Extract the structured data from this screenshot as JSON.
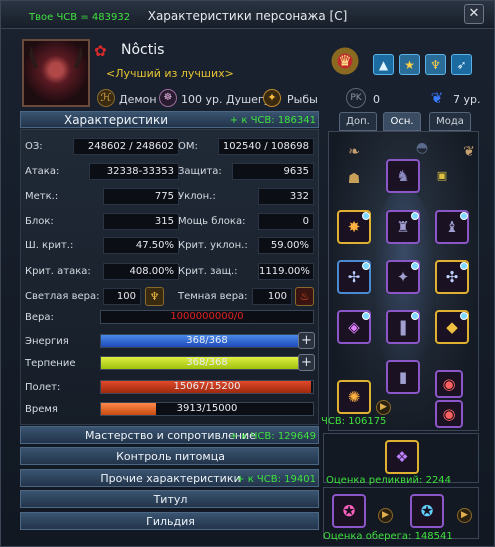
{
  "window": {
    "title": "Характеристики персонажа [C]",
    "score": "Твое ЧСВ = 483932",
    "close": "✕"
  },
  "character": {
    "name": "Nôctis",
    "title": "Лучший из лучших",
    "race": "Демон",
    "level": "100 ур. Душегуб",
    "profession": "Рыбы",
    "pk": "0",
    "rank_level": "7 ур."
  },
  "stats_header": {
    "label": "Характеристики",
    "bonus": "+ к ЧСВ: 186341"
  },
  "stats": {
    "hp_label": "ОЗ:",
    "hp": "248602 / 248602",
    "mp_label": "ОМ:",
    "mp": "102540 / 108698",
    "attack_label": "Атака:",
    "attack": "32338-33353",
    "defense_label": "Защита:",
    "defense": "9635",
    "accuracy_label": "Метк.:",
    "accuracy": "775",
    "evasion_label": "Уклон.:",
    "evasion": "332",
    "block_label": "Блок:",
    "block": "315",
    "block_power_label": "Мощь блока:",
    "block_power": "0",
    "crit_chance_label": "Ш. крит.:",
    "crit_chance": "47.50%",
    "crit_evasion_label": "Крит. уклон.:",
    "crit_evasion": "59.00%",
    "crit_attack_label": "Крит. атака:",
    "crit_attack": "408.00%",
    "crit_defense_label": "Крит. защ.:",
    "crit_defense": "1119.00%",
    "light_faith_label": "Светлая вера:",
    "light_faith": "100",
    "dark_faith_label": "Темная вера:",
    "dark_faith": "100"
  },
  "bars": {
    "faith": {
      "label": "Вера:",
      "value": "1000000000/0",
      "fill": 0
    },
    "energy": {
      "label": "Энергия",
      "value": "368/368",
      "fill": 1.0
    },
    "patience": {
      "label": "Терпение",
      "value": "368/368",
      "fill": 1.0
    },
    "flight": {
      "label": "Полет:",
      "value": "15067/15200",
      "fill": 0.991
    },
    "time": {
      "label": "Время",
      "value": "3913/15000",
      "fill": 0.261
    }
  },
  "sections": [
    {
      "label": "Мастерство и сопротивление",
      "bonus": "+ к ЧСВ: 129649"
    },
    {
      "label": "Контроль питомца",
      "bonus": ""
    },
    {
      "label": "Прочие характеристики",
      "bonus": "+ к ЧСВ: 19401"
    },
    {
      "label": "Титул",
      "bonus": ""
    },
    {
      "label": "Гильдия",
      "bonus": ""
    }
  ],
  "tabs": [
    "Доп.",
    "Осн.",
    "Мода"
  ],
  "equipment": {
    "score": "ЧСВ: 106175",
    "relic_score": "Оценка реликвий: 2244",
    "amulet_score": "Оценка оберега: 148541"
  },
  "colors": {
    "accent_green": "#3fe13f",
    "faith_red": "#e02020",
    "energy_blue": "#2a6ad8",
    "patience_yellow": "#c8e020",
    "flight_red": "#c83a1e",
    "time_orange": "#e8682a"
  },
  "icons": {
    "rose": "rose-icon",
    "race": "race-icon",
    "level": "level-icon",
    "profession": "profession-icon",
    "rank": "rank-emblem-icon",
    "pk": "pk-icon",
    "wings": "wings-icon"
  }
}
